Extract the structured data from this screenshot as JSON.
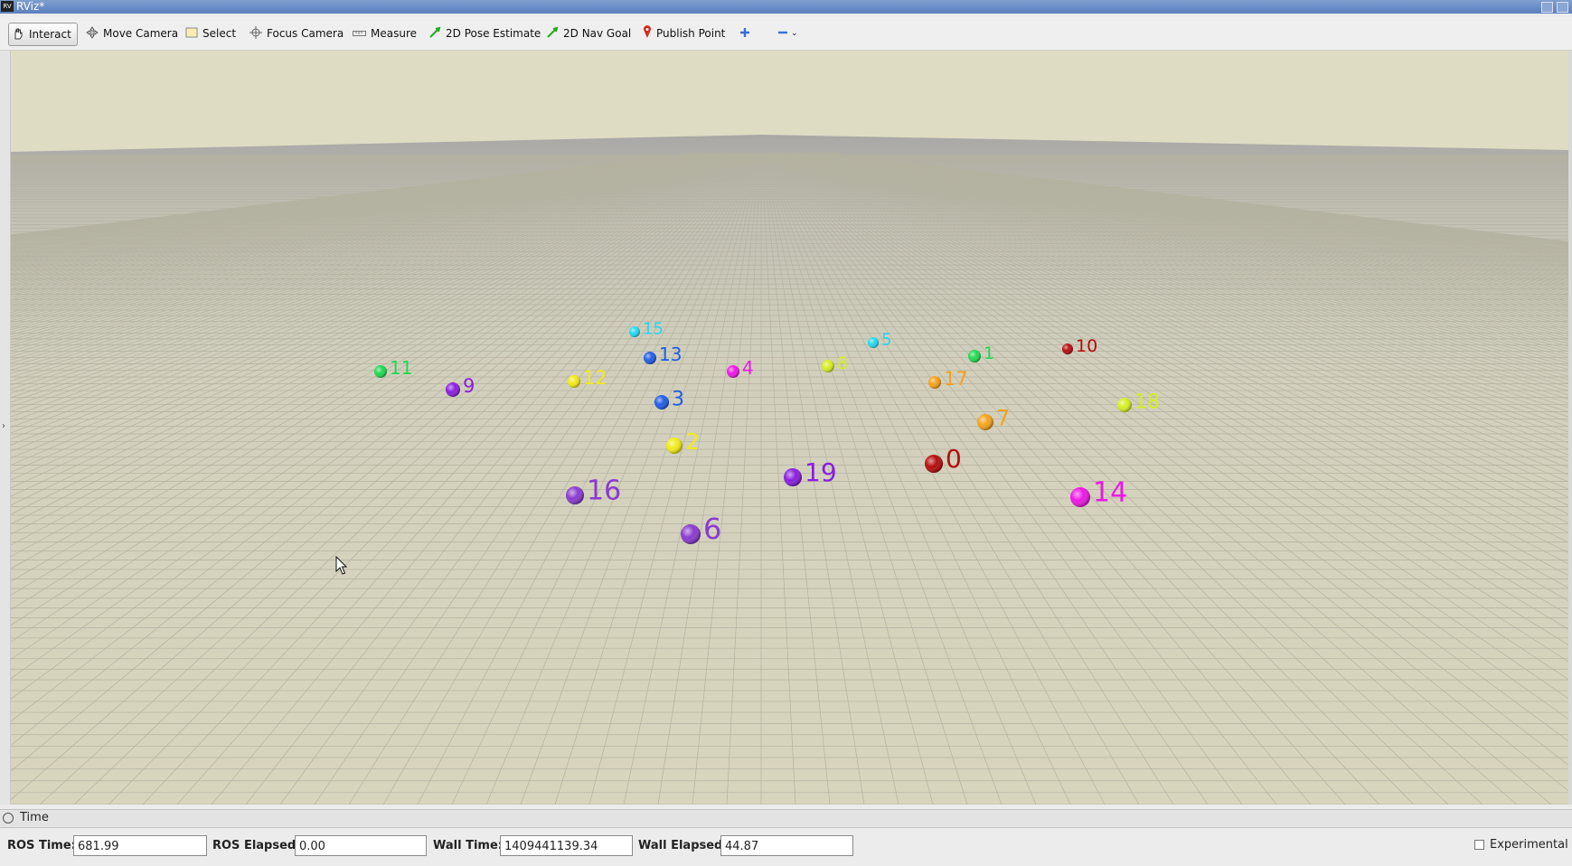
{
  "window": {
    "title": "RViz*"
  },
  "toolbar": {
    "tools": [
      {
        "label": "Interact",
        "icon": "hand-icon"
      },
      {
        "label": "Move Camera",
        "icon": "move-camera-icon"
      },
      {
        "label": "Select",
        "icon": "select-box-icon"
      },
      {
        "label": "Focus Camera",
        "icon": "focus-crosshair-icon"
      },
      {
        "label": "Measure",
        "icon": "ruler-icon"
      },
      {
        "label": "2D Pose Estimate",
        "icon": "green-arrow-icon"
      },
      {
        "label": "2D Nav Goal",
        "icon": "green-arrow-icon"
      },
      {
        "label": "Publish Point",
        "icon": "map-pin-icon"
      }
    ]
  },
  "markers": [
    {
      "label": "15",
      "color": "#22d8f0"
    },
    {
      "label": "13",
      "color": "#1f5be8"
    },
    {
      "label": "11",
      "color": "#1ed84f"
    },
    {
      "label": "9",
      "color": "#8a1ee0"
    },
    {
      "label": "12",
      "color": "#f2ea16"
    },
    {
      "label": "4",
      "color": "#ee16e6"
    },
    {
      "label": "8",
      "color": "#d6ee20"
    },
    {
      "label": "5",
      "color": "#22d8f0"
    },
    {
      "label": "1",
      "color": "#1ed84f"
    },
    {
      "label": "10",
      "color": "#b40c0c"
    },
    {
      "label": "17",
      "color": "#f5a11a"
    },
    {
      "label": "3",
      "color": "#1f5be8"
    },
    {
      "label": "18",
      "color": "#d6ee20"
    },
    {
      "label": "7",
      "color": "#f5a11a"
    },
    {
      "label": "2",
      "color": "#f2ea16"
    },
    {
      "label": "0",
      "color": "#b40c0c"
    },
    {
      "label": "19",
      "color": "#8a1ee0"
    },
    {
      "label": "16",
      "color": "#8a3ad0"
    },
    {
      "label": "14",
      "color": "#ee16e6"
    },
    {
      "label": "6",
      "color": "#8a3ad0"
    }
  ],
  "time_panel": {
    "title": "Time",
    "ros_time_label": "ROS Time:",
    "ros_time": "681.99",
    "ros_elapsed_label": "ROS Elapsed:",
    "ros_elapsed": "0.00",
    "wall_time_label": "Wall Time:",
    "wall_time": "1409441139.34",
    "wall_elapsed_label": "Wall Elapsed:",
    "wall_elapsed": "44.87",
    "experimental_label": "Experimental",
    "experimental_checked": false
  }
}
